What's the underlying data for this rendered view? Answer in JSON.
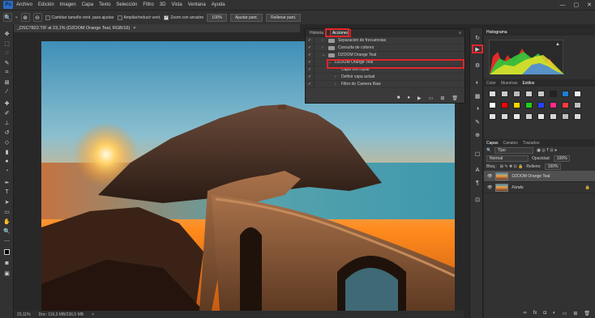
{
  "menubar": {
    "logo": "Ps",
    "items": [
      "Archivo",
      "Edición",
      "Imagen",
      "Capa",
      "Texto",
      "Selección",
      "Filtro",
      "3D",
      "Vista",
      "Ventana",
      "Ayuda"
    ],
    "window_controls": [
      "—",
      "▢",
      "✕"
    ]
  },
  "options": {
    "zoom_tool": "zoom-tool-icon",
    "chk_ajustar": {
      "label": "Cambiar tamaño vent. para ajustar",
      "checked": false
    },
    "chk_ampliar": {
      "label": "Ampliar/reducir vent.",
      "checked": false
    },
    "chk_arrastre": {
      "label": "Zoom con arrastre",
      "checked": true
    },
    "zoom_value": "100%",
    "ajustar_button": "Ajustar pant.",
    "rellenar_button": "Rellenar pant."
  },
  "document": {
    "tab_title": "_DSC7822.TIF al 23,1% (DZOOM Orange Teal, RGB/16)",
    "close": "×"
  },
  "statusbar": {
    "zoom": "23,11%",
    "doc_info": "Doc: 116,3 MB/236,5 MB",
    "arrow": ">"
  },
  "actions_panel": {
    "tabs": [
      "Historia",
      "Acciones"
    ],
    "active_tab": "Acciones",
    "rows": [
      {
        "label": "Separacion de frecuencias",
        "type": "folder",
        "indent": 1
      },
      {
        "label": "Consulta de colores",
        "type": "folder",
        "indent": 1
      },
      {
        "label": "DZOOM Orange Teal",
        "type": "folder",
        "indent": 1
      },
      {
        "label": "DZOOM Orange Teal",
        "type": "action",
        "indent": 2
      },
      {
        "label": "Capa vía copiar",
        "type": "step",
        "indent": 3
      },
      {
        "label": "Definir capa actual",
        "type": "step",
        "indent": 3
      },
      {
        "label": "Filtro de Camera Raw",
        "type": "step",
        "indent": 3
      }
    ],
    "footer_icons": [
      "stop-icon",
      "record-icon",
      "play-icon",
      "new-set-icon",
      "new-action-icon",
      "trash-icon"
    ]
  },
  "histogram": {
    "tab": "Histograma",
    "warning": "▲"
  },
  "color_panel": {
    "tabs": [
      "Color",
      "Muestras",
      "Estilos"
    ],
    "active": "Estilos"
  },
  "layers_panel": {
    "tabs": [
      "Capas",
      "Canales",
      "Trazados"
    ],
    "filter_label": "Tipo",
    "blend_mode": "Normal",
    "opacity_label": "Opacidad:",
    "opacity_value": "100%",
    "lock_label": "Bloq.:",
    "fill_label": "Relleno:",
    "fill_value": "100%",
    "layers": [
      {
        "name": "DZOOM Orange Teal",
        "active": true,
        "locked": false
      },
      {
        "name": "Fondo",
        "active": false,
        "locked": true
      }
    ],
    "footer_icons": [
      "link-icon",
      "fx-icon",
      "mask-icon",
      "adjustment-icon",
      "group-icon",
      "new-layer-icon",
      "trash-icon"
    ]
  },
  "colors": {
    "accent_red": "#e3252a",
    "ui_bg": "#323232",
    "panel_bg": "#3a3a3a"
  }
}
